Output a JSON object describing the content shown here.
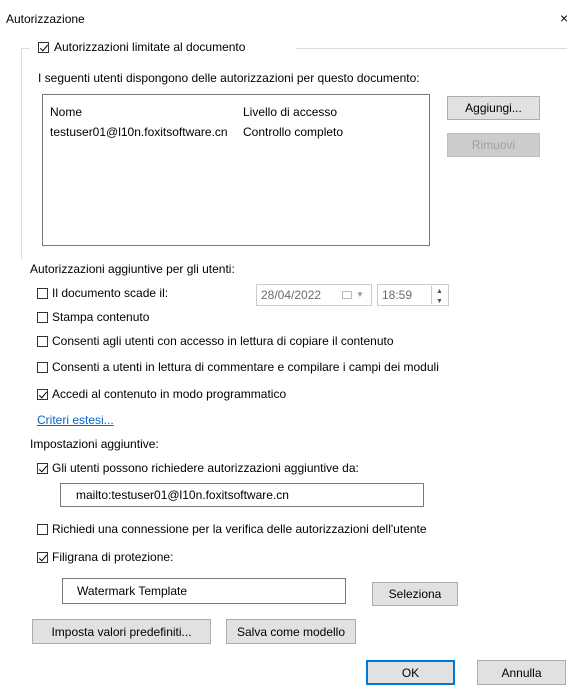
{
  "dialog": {
    "title": "Autorizzazione",
    "close_glyph": "×"
  },
  "restricted": {
    "label": "Autorizzazioni limitate al documento",
    "checked": true,
    "description": "I seguenti utenti dispongono delle autorizzazioni per questo documento:",
    "columns": [
      "Nome",
      "Livello di accesso"
    ],
    "rows": [
      {
        "name": "testuser01@l10n.foxitsoftware.cn",
        "level": "Controllo completo"
      }
    ],
    "add_button": "Aggiungi...",
    "remove_button": "Rimuovi"
  },
  "additional_permissions": {
    "heading": "Autorizzazioni aggiuntive per gli utenti:",
    "expires_label": "Il documento scade il:",
    "expires_checked": false,
    "date_value": "28/04/2022",
    "time_value": "18:59",
    "print_label": "Stampa contenuto",
    "print_checked": false,
    "copy_label": "Consenti agli utenti con accesso in lettura di copiare il contenuto",
    "copy_checked": false,
    "comment_label": "Consenti a utenti in lettura di commentare e compilare i campi dei moduli",
    "comment_checked": false,
    "programmatic_label": "Accedi al contenuto in modo programmatico",
    "programmatic_checked": true,
    "extended_policy_link": "Criteri estesi..."
  },
  "additional_settings": {
    "heading": "Impostazioni aggiuntive:",
    "request_label": "Gli utenti possono richiedere autorizzazioni aggiuntive da:",
    "request_checked": true,
    "request_value": "mailto:testuser01@l10n.foxitsoftware.cn",
    "connection_label": "Richiedi una connessione per la verifica delle autorizzazioni dell'utente",
    "connection_checked": false,
    "watermark_label": "Filigrana di protezione:",
    "watermark_checked": true,
    "watermark_value": "Watermark Template",
    "select_button": "Seleziona"
  },
  "footer": {
    "defaults_button": "Imposta valori predefiniti...",
    "save_template_button": "Salva come modello",
    "ok_button": "OK",
    "cancel_button": "Annulla"
  }
}
